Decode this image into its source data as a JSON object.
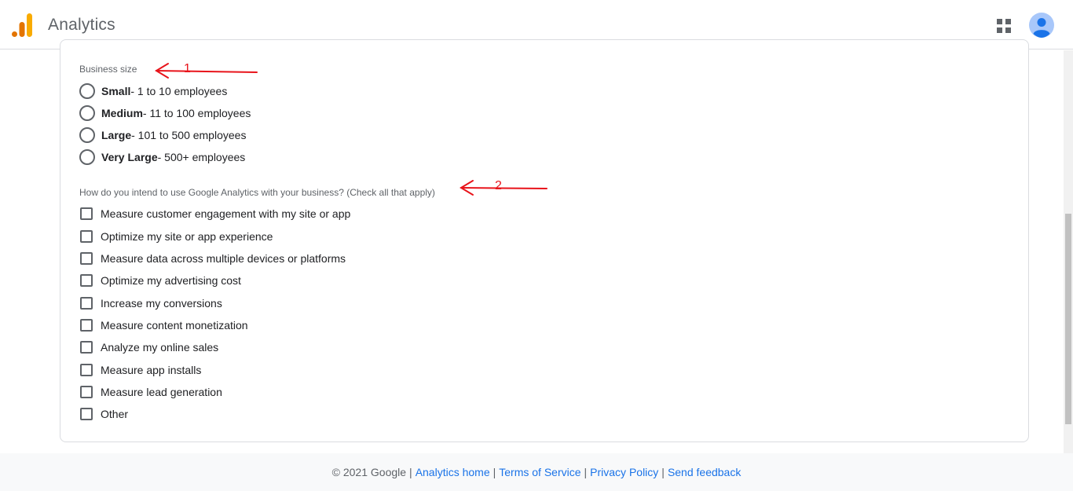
{
  "header": {
    "title": "Analytics",
    "icons": {
      "logo": "analytics-logo",
      "apps": "apps-grid-icon",
      "account": "account-avatar"
    }
  },
  "business_size": {
    "label": "Business size",
    "options": [
      {
        "bold": "Small",
        "rest": " - 1 to 10 employees",
        "selected": false
      },
      {
        "bold": "Medium",
        "rest": " - 11 to 100 employees",
        "selected": false
      },
      {
        "bold": "Large",
        "rest": " - 101 to 500 employees",
        "selected": false
      },
      {
        "bold": "Very Large",
        "rest": " - 500+ employees",
        "selected": false
      }
    ]
  },
  "usage": {
    "label": "How do you intend to use Google Analytics with your business? (Check all that apply)",
    "options": [
      {
        "label": "Measure customer engagement with my site or app",
        "checked": false
      },
      {
        "label": "Optimize my site or app experience",
        "checked": false
      },
      {
        "label": "Measure data across multiple devices or platforms",
        "checked": false
      },
      {
        "label": "Optimize my advertising cost",
        "checked": false
      },
      {
        "label": "Increase my conversions",
        "checked": false
      },
      {
        "label": "Measure content monetization",
        "checked": false
      },
      {
        "label": "Analyze my online sales",
        "checked": false
      },
      {
        "label": "Measure app installs",
        "checked": false
      },
      {
        "label": "Measure lead generation",
        "checked": false
      },
      {
        "label": "Other",
        "checked": false
      }
    ]
  },
  "annotations": [
    "1",
    "2"
  ],
  "footer": {
    "copyright": "© 2021 Google",
    "links": [
      "Analytics home",
      "Terms of Service",
      "Privacy Policy",
      "Send feedback"
    ],
    "separator": "|"
  },
  "colors": {
    "accent": "#1a73e8",
    "annotation": "#e8141b",
    "logo_orange": "#f9ab00",
    "logo_dark": "#e37400"
  }
}
